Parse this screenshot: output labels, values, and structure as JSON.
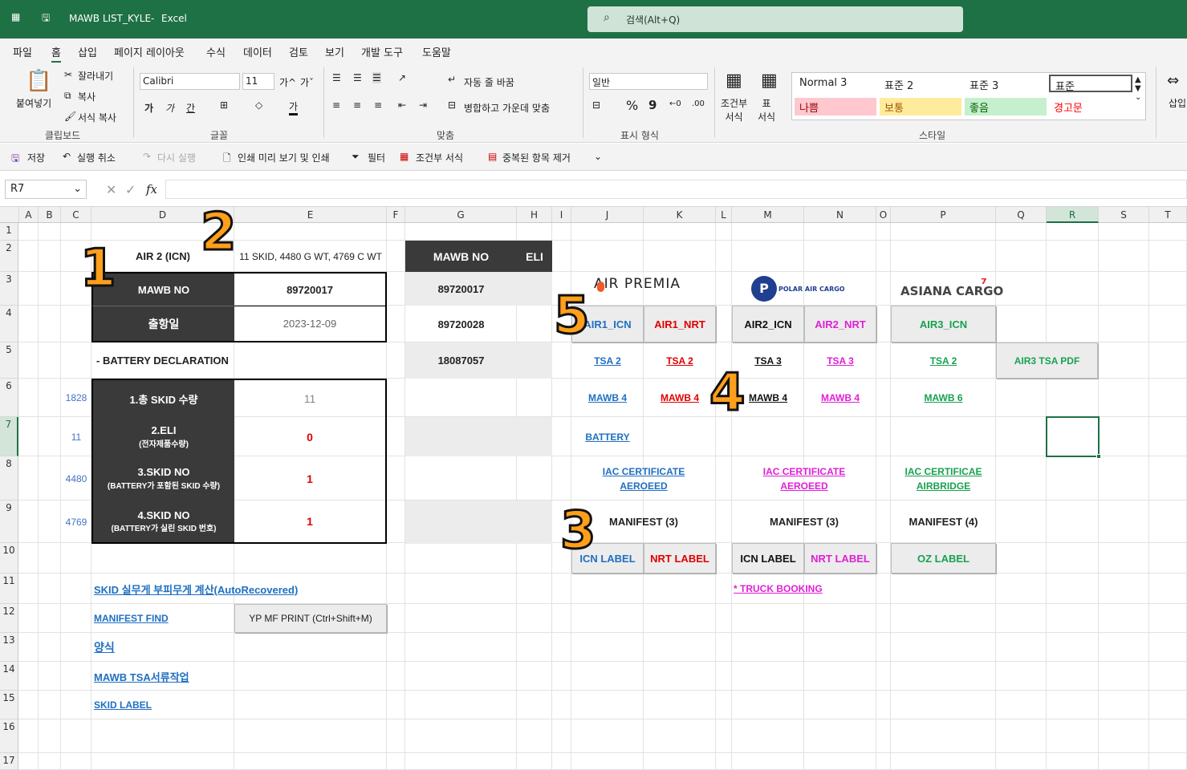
{
  "window": {
    "file_title": "MAWB LIST_KYLE",
    "separator": "-",
    "app": "Excel",
    "search_placeholder": "검색(Alt+Q)"
  },
  "menu": [
    "파일",
    "홈",
    "삽입",
    "페이지 레이아웃",
    "수식",
    "데이터",
    "검토",
    "보기",
    "개발 도구",
    "도움말"
  ],
  "ribbon": {
    "clipboard": {
      "paste": "붙여넣기",
      "cut": "잘라내기",
      "copy": "복사",
      "format_painter": "서식 복사",
      "group": "클립보드"
    },
    "font": {
      "name": "Calibri",
      "size": "11",
      "group": "글꼴",
      "inc": "가^",
      "dec": "가ˇ",
      "bold": "가",
      "italic": "가",
      "underline": "간",
      "fontcolor": "가"
    },
    "align": {
      "wrap": "자동 줄 바꿈",
      "merge": "병합하고 가운데 맞춤",
      "group": "맞춤"
    },
    "number": {
      "format": "일반",
      "group": "표시 형식",
      "percent": "%",
      "comma": "9"
    },
    "styles": {
      "cond": "조건부\n서식",
      "table": "표\n서식",
      "group": "스타일",
      "cells": [
        "Normal 3",
        "표준 2",
        "표준 3",
        "표준",
        "나쁨",
        "보통",
        "좋음",
        "경고문"
      ]
    },
    "insert": "삽입"
  },
  "qat": {
    "save": "저장",
    "undo": "실행 취소",
    "redo": "다시 실행",
    "print": "인쇄 미리 보기 및 인쇄",
    "filter": "필터",
    "cond": "조건부 서식",
    "dedupe": "중복된 항목 제거"
  },
  "formula": {
    "namebox": "R7",
    "fx": "fx",
    "content": ""
  },
  "columns": [
    "A",
    "B",
    "C",
    "D",
    "E",
    "F",
    "G",
    "H",
    "I",
    "J",
    "K",
    "L",
    "M",
    "N",
    "O",
    "P",
    "Q",
    "R",
    "S",
    "T"
  ],
  "rows": [
    "1",
    "2",
    "3",
    "4",
    "5",
    "6",
    "7",
    "8",
    "9",
    "10",
    "11",
    "12",
    "13",
    "14",
    "15",
    "16",
    "17"
  ],
  "sheet": {
    "d2": "AIR 2 (ICN)",
    "e2": "11 SKID, 4480 G WT, 4769 C WT",
    "d3": "MAWB NO",
    "e3": "89720017",
    "d4": "출항일",
    "e4": "2023-12-09",
    "d5": "- BATTERY DECLARATION",
    "d6": "1.총 SKID 수량",
    "e6": "11",
    "d7a": "2.ELI",
    "d7b": "(전자제품수량)",
    "e7": "0",
    "d8a": "3.SKID NO",
    "d8b": "(BATTERY가 포함된 SKID 수량)",
    "e8": "1",
    "d9a": "4.SKID NO",
    "d9b": "(BATTERY가 실린 SKID 번호)",
    "e9": "1",
    "c6": "1828",
    "c7": "11",
    "c8": "4480",
    "c9": "4769",
    "g2": "MAWB NO",
    "h2": "ELI",
    "g3": "89720017",
    "g4": "89720028",
    "g5": "18087057",
    "d11": "SKID 실무게 부피무게 계산(AutoRecovered)",
    "d12": "MANIFEST FIND",
    "e12": "YP MF PRINT (Ctrl+Shift+M)",
    "d13": "양식",
    "d14": "MAWB TSA서류작업",
    "d15": "SKID LABEL",
    "logo_airpremia": "AIR PREMIA",
    "logo_polar": "POLAR AIR CARGO",
    "logo_asiana": "ASIANA CARGO",
    "j4": "AIR1_ICN",
    "k4": "AIR1_NRT",
    "m4": "AIR2_ICN",
    "n4": "AIR2_NRT",
    "p4": "AIR3_ICN",
    "j5": "TSA 2",
    "k5": "TSA 2",
    "m5": "TSA 3",
    "n5": "TSA 3",
    "p5": "TSA 2",
    "q5": "AIR3 TSA PDF",
    "j6": "MAWB 4",
    "k6": "MAWB 4",
    "m6": "MAWB 4",
    "n6": "MAWB 4",
    "p6": "MAWB 6",
    "j7": "BATTERY",
    "j8a": "IAC CERTIFICATE",
    "j8b": "AEROEED",
    "m8a": "IAC CERTIFICATE",
    "m8b": "AEROEED",
    "p8a": "IAC CERTIFICAE",
    "p8b": "AIRBRIDGE",
    "j9": "MANIFEST (3)",
    "m9": "MANIFEST (3)",
    "p9": "MANIFEST (4)",
    "j10": "ICN LABEL",
    "k10": "NRT LABEL",
    "m10": "ICN LABEL",
    "n10": "NRT LABEL",
    "p10": "OZ LABEL",
    "m11": "* TRUCK BOOKING"
  },
  "overlay_numbers": [
    "1",
    "2",
    "3",
    "4",
    "5"
  ],
  "colors": {
    "excel_green": "#1e7145",
    "blue": "#1f6fc1",
    "red": "#e00000",
    "magenta": "#e01fd6",
    "green": "#18a150",
    "selection": "#1e7145"
  }
}
